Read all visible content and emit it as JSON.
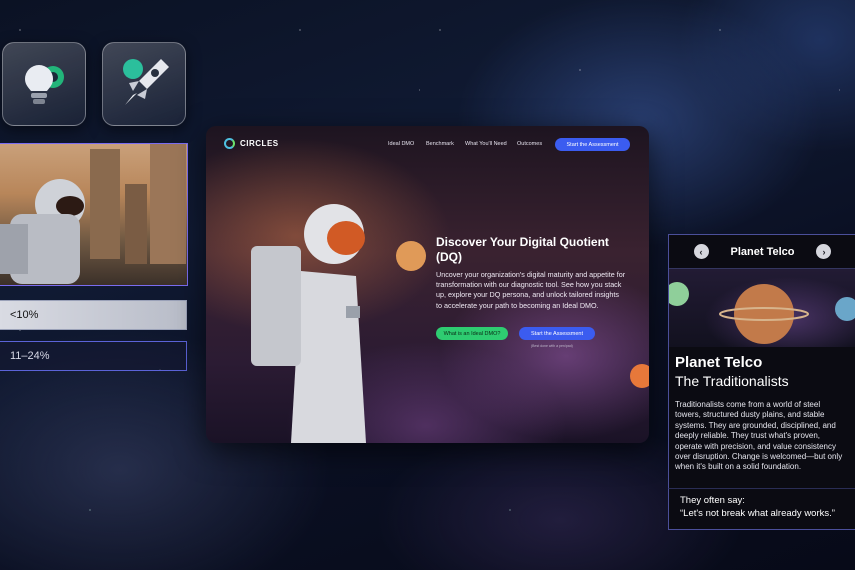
{
  "main_site": {
    "logo_text": "CIRCLES",
    "nav": [
      "Ideal DMO",
      "Benchmark",
      "What You'll Need",
      "Outcomes"
    ],
    "nav_cta": "Start the Assessment",
    "hero_title": "Discover Your Digital Quotient (DQ)",
    "hero_body": "Uncover your organization's digital maturity and appetite for transformation with our diagnostic tool. See how you stack up, explore your DQ persona, and unlock tailored insights to accelerate your path to becoming an Ideal DMO.",
    "primary_button": "What is an Ideal DMO?",
    "secondary_button": "Start the Assessment",
    "button_note": "(Best done with a pen/pad)"
  },
  "options": [
    {
      "label": "<10%",
      "selected": true
    },
    {
      "label": "11–24%",
      "selected": false
    }
  ],
  "planet_card": {
    "header": "Planet Telco",
    "prev_icon": "‹",
    "next_icon": "›",
    "name": "Planet Telco",
    "subtitle": "The Traditionalists",
    "description": "Traditionalists come from a world of steel towers, structured dusty plains, and stable systems. They are grounded, disciplined, and deeply reliable. They trust what's proven, operate with precision, and value consistency over disruption. Change is welcomed—but only when it's built on a solid foundation.",
    "quote_intro": "They often say:",
    "quote": "“Let's not break what already works.”"
  },
  "icons": {
    "tile1": "lightbulb-gear-icon",
    "tile2": "rocket-icon"
  },
  "colors": {
    "accent_blue": "#3b5cf0",
    "accent_green": "#2ecc71",
    "border_purple": "#5b63d8"
  }
}
